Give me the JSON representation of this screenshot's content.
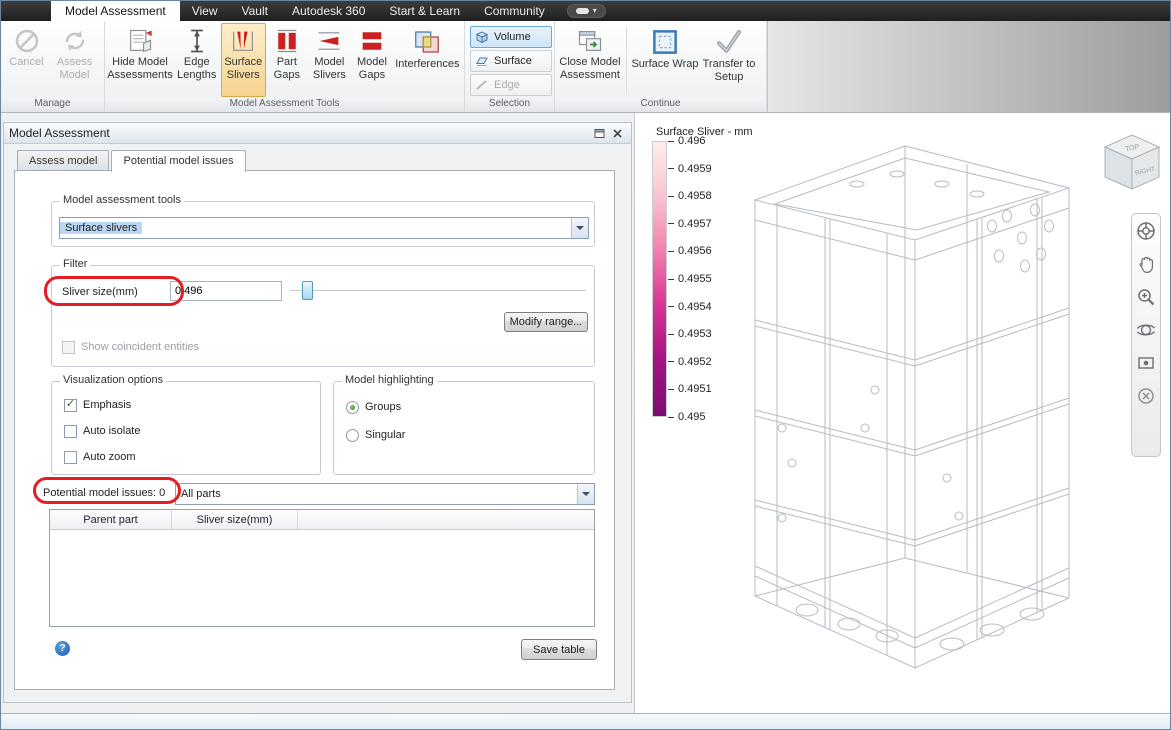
{
  "annotation_color": "#e21d23",
  "menubar": {
    "active_tab": "Model Assessment",
    "items": [
      "View",
      "Vault",
      "Autodesk 360",
      "Start & Learn",
      "Community"
    ]
  },
  "ribbon": {
    "manage": {
      "label": "Manage",
      "cancel_label": "Cancel",
      "cancel_disabled": true,
      "assess_label": "Assess Model",
      "assess_disabled": true
    },
    "tools": {
      "label": "Model Assessment Tools",
      "hide_label": "Hide Model Assessments",
      "edge_lengths_label": "Edge Lengths",
      "surface_slivers_label": "Surface Slivers",
      "surface_slivers_active": true,
      "part_gaps_label": "Part Gaps",
      "model_slivers_label": "Model Slivers",
      "model_gaps_label": "Model Gaps",
      "interferences_label": "Interferences"
    },
    "selection": {
      "label": "Selection",
      "volume_label": "Volume",
      "volume_active": true,
      "surface_label": "Surface",
      "edge_label": "Edge",
      "edge_disabled": true
    },
    "continue": {
      "label": "Continue",
      "close_label": "Close Model Assessment",
      "surface_wrap_label": "Surface Wrap",
      "transfer_label": "Transfer to Setup"
    }
  },
  "panel": {
    "title": "Model Assessment",
    "tab_assess": "Assess model",
    "tab_issues": "Potential model issues",
    "tools_group": {
      "label": "Model assessment tools",
      "dropdown_value": "Surface slivers"
    },
    "filter_group": {
      "label": "Filter",
      "sliver_size_label": "Sliver size(mm)",
      "sliver_size_value": "0.496",
      "modify_range_button": "Modify range...",
      "coincident_label": "Show coincident entities",
      "coincident_checked": false,
      "coincident_disabled": true
    },
    "visualization_group": {
      "label": "Visualization options",
      "emphasis_label": "Emphasis",
      "emphasis_checked": true,
      "auto_isolate_label": "Auto isolate",
      "auto_isolate_checked": false,
      "auto_zoom_label": "Auto zoom",
      "auto_zoom_checked": false
    },
    "highlighting_group": {
      "label": "Model highlighting",
      "groups_label": "Groups",
      "groups_selected": true,
      "singular_label": "Singular",
      "singular_selected": false
    },
    "issues_count_label": "Potential model issues: 0",
    "parts_dropdown_value": "All parts",
    "table": {
      "headers": [
        "Parent part",
        "Sliver size(mm)"
      ],
      "rows": []
    },
    "help_glyph": "?",
    "save_table_button": "Save table"
  },
  "viewport": {
    "legend": {
      "title": "Surface Sliver - mm",
      "ticks": [
        "0.496",
        "0.4959",
        "0.4958",
        "0.4957",
        "0.4956",
        "0.4955",
        "0.4954",
        "0.4953",
        "0.4952",
        "0.4951",
        "0.495"
      ],
      "gradient_stops": [
        "#fdeeea",
        "#f9c4cf",
        "#f07fae",
        "#d63493",
        "#a3147f",
        "#7c0e72"
      ]
    },
    "viewcube": {
      "top_label": "TOP",
      "right_label": "RIGHT"
    }
  }
}
